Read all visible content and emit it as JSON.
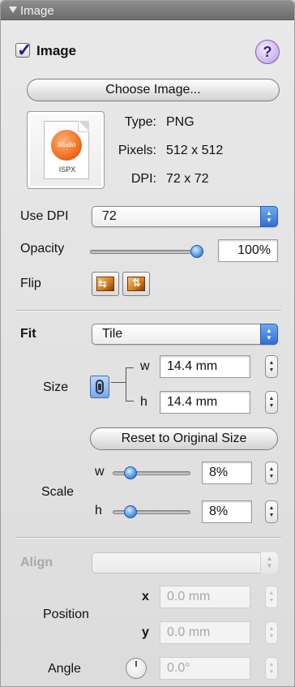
{
  "window": {
    "title": "Image"
  },
  "image_section": {
    "checkbox_label": "Image",
    "checked": true,
    "help_label": "?",
    "choose_button": "Choose Image...",
    "preview_ext": "ISPX",
    "preview_logo": "Studio",
    "type_label": "Type:",
    "type_value": "PNG",
    "pixels_label": "Pixels:",
    "pixels_value": "512 x 512",
    "dpi_label": "DPI:",
    "dpi_value": "72 x 72",
    "use_dpi_label": "Use DPI",
    "use_dpi_value": "72",
    "opacity_label": "Opacity",
    "opacity_value": "100%",
    "opacity_level": 1.0,
    "flip_label": "Flip"
  },
  "fit_section": {
    "fit_label": "Fit",
    "fit_value": "Tile",
    "size_label": "Size",
    "w_label": "w",
    "w_value": "14.4 mm",
    "h_label": "h",
    "h_value": "14.4 mm",
    "reset_button": "Reset to Original Size",
    "scale_label": "Scale",
    "scale_w_label": "w",
    "scale_w_value": "8%",
    "scale_h_label": "h",
    "scale_h_value": "8%",
    "scale_w_level": 0.08,
    "scale_h_level": 0.08
  },
  "align_section": {
    "align_label": "Align",
    "align_value": "",
    "position_label": "Position",
    "x_label": "x",
    "x_value": "0.0 mm",
    "y_label": "y",
    "y_value": "0.0 mm",
    "angle_label": "Angle",
    "angle_value": "0.0°"
  },
  "colors": {
    "accent": "#2f6fd4",
    "titlebar": "#7a7a7a",
    "panel": "#e3e3e3"
  },
  "icons": [
    "disclosure-triangle-icon",
    "help-icon",
    "image-file-icon",
    "flip-horizontal-icon",
    "flip-vertical-icon",
    "link-aspect-icon",
    "angle-dial-icon"
  ]
}
